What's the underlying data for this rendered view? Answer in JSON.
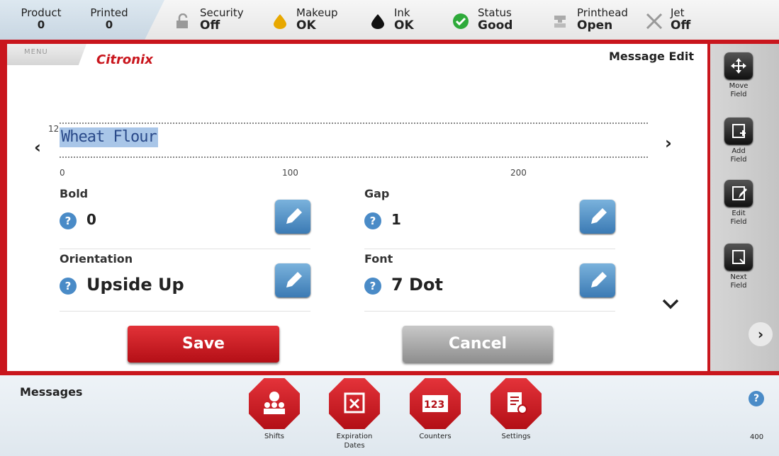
{
  "status_bar": {
    "product": {
      "label": "Product",
      "value": "0"
    },
    "printed": {
      "label": "Printed",
      "value": "0"
    },
    "items": [
      {
        "label": "Security",
        "value": "Off",
        "icon": "lock-open-icon"
      },
      {
        "label": "Makeup",
        "value": "OK",
        "icon": "makeup-drop-icon"
      },
      {
        "label": "Ink",
        "value": "OK",
        "icon": "ink-drop-icon"
      },
      {
        "label": "Status",
        "value": "Good",
        "icon": "check-circle-icon"
      },
      {
        "label": "Printhead",
        "value": "Open",
        "icon": "printhead-icon"
      },
      {
        "label": "Jet",
        "value": "Off",
        "icon": "x-icon"
      }
    ]
  },
  "header": {
    "menu_label": "MENU",
    "logo_text": "Citronix",
    "page_title": "Message Edit"
  },
  "preview": {
    "row_number": "12",
    "message_text": "Wheat Flour",
    "ruler_ticks": [
      "0",
      "100",
      "200"
    ]
  },
  "properties": [
    {
      "label": "Bold",
      "value": "0"
    },
    {
      "label": "Gap",
      "value": "1"
    },
    {
      "label": "Orientation",
      "value": "Upside Up"
    },
    {
      "label": "Font",
      "value": "7 Dot"
    }
  ],
  "actions": {
    "save": "Save",
    "cancel": "Cancel"
  },
  "toolbar": [
    {
      "label_line1": "Move",
      "label_line2": "Field"
    },
    {
      "label_line1": "Add",
      "label_line2": "Field"
    },
    {
      "label_line1": "Edit",
      "label_line2": "Field"
    },
    {
      "label_line1": "Next",
      "label_line2": "Field"
    }
  ],
  "bottom": {
    "section_label": "Messages",
    "nav": [
      {
        "label_line1": "Shifts",
        "label_line2": ""
      },
      {
        "label_line1": "Expiration",
        "label_line2": "Dates"
      },
      {
        "label_line1": "Counters",
        "label_line2": ""
      },
      {
        "label_line1": "Settings",
        "label_line2": ""
      }
    ],
    "code": "400"
  },
  "colors": {
    "brand_red": "#c9161d",
    "edit_blue": "#3b7ab4",
    "help_blue": "#4a8bc7",
    "status_green": "#2eaa3a",
    "makeup_yellow": "#e8a800",
    "highlight": "#a9c6e8"
  }
}
